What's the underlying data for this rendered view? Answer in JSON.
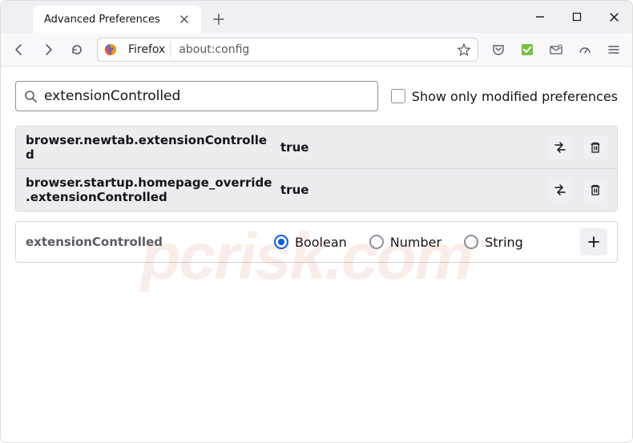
{
  "tab": {
    "title": "Advanced Preferences"
  },
  "urlbar": {
    "identity": "Firefox",
    "url": "about:config"
  },
  "search": {
    "value": "extensionControlled"
  },
  "checkbox": {
    "label": "Show only modified preferences",
    "checked": false
  },
  "prefs": [
    {
      "name": "browser.newtab.extensionControlled",
      "value": "true"
    },
    {
      "name": "browser.startup.homepage_override.extensionControlled",
      "value": "true"
    }
  ],
  "newpref": {
    "name": "extensionControlled",
    "types": [
      {
        "label": "Boolean",
        "selected": true
      },
      {
        "label": "Number",
        "selected": false
      },
      {
        "label": "String",
        "selected": false
      }
    ]
  },
  "watermark": "pcrisk.com"
}
